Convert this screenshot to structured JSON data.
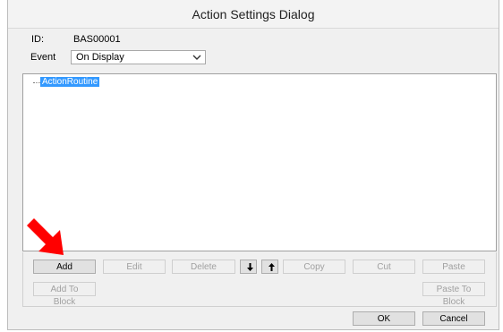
{
  "dialog": {
    "title": "Action Settings Dialog",
    "id_label": "ID:",
    "id_value": "BAS00001",
    "event_label": "Event",
    "event_value": "On Display"
  },
  "tree": {
    "root_label": "ActionRoutine"
  },
  "buttons": {
    "add": "Add",
    "edit": "Edit",
    "delete": "Delete",
    "copy": "Copy",
    "cut": "Cut",
    "paste": "Paste",
    "add_to_block": "Add To Block",
    "paste_to_block": "Paste To Block",
    "ok": "OK",
    "cancel": "Cancel"
  },
  "icons": {
    "move_down": "arrow-down-icon",
    "move_up": "arrow-up-icon",
    "dropdown": "chevron-down-icon",
    "indicator": "red-arrow-icon"
  },
  "colors": {
    "selection": "#3399ff",
    "indicator": "#ff0000"
  }
}
